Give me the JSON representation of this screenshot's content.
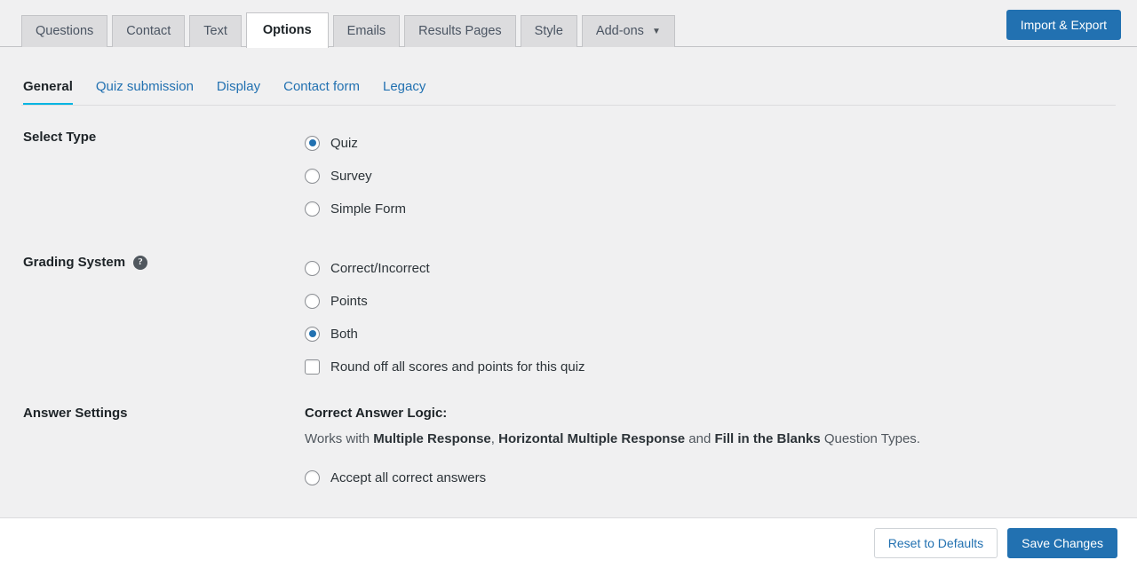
{
  "header": {
    "tabs": [
      {
        "label": "Questions",
        "active": false,
        "caret": false
      },
      {
        "label": "Contact",
        "active": false,
        "caret": false
      },
      {
        "label": "Text",
        "active": false,
        "caret": false
      },
      {
        "label": "Options",
        "active": true,
        "caret": false
      },
      {
        "label": "Emails",
        "active": false,
        "caret": false
      },
      {
        "label": "Results Pages",
        "active": false,
        "caret": false
      },
      {
        "label": "Style",
        "active": false,
        "caret": false
      },
      {
        "label": "Add-ons",
        "active": false,
        "caret": true,
        "caret_glyph": "▼"
      }
    ],
    "import_export_label": "Import & Export"
  },
  "subnav": {
    "items": [
      {
        "label": "General",
        "active": true
      },
      {
        "label": "Quiz submission",
        "active": false
      },
      {
        "label": "Display",
        "active": false
      },
      {
        "label": "Contact form",
        "active": false
      },
      {
        "label": "Legacy",
        "active": false
      }
    ]
  },
  "select_type": {
    "label": "Select Type",
    "options": [
      {
        "label": "Quiz",
        "checked": true
      },
      {
        "label": "Survey",
        "checked": false
      },
      {
        "label": "Simple Form",
        "checked": false
      }
    ]
  },
  "grading_system": {
    "label": "Grading System",
    "help_glyph": "?",
    "options": [
      {
        "label": "Correct/Incorrect",
        "checked": false
      },
      {
        "label": "Points",
        "checked": false
      },
      {
        "label": "Both",
        "checked": true
      }
    ],
    "round_off": {
      "label": "Round off all scores and points for this quiz",
      "checked": false
    }
  },
  "answer_settings": {
    "label": "Answer Settings",
    "logic_title": "Correct Answer Logic:",
    "logic_desc_parts": [
      {
        "text": "Works with ",
        "bold": false
      },
      {
        "text": "Multiple Response",
        "bold": true
      },
      {
        "text": ", ",
        "bold": false
      },
      {
        "text": "Horizontal Multiple Response",
        "bold": true
      },
      {
        "text": " and ",
        "bold": false
      },
      {
        "text": "Fill in the Blanks",
        "bold": true
      },
      {
        "text": " Question Types.",
        "bold": false
      }
    ],
    "options": [
      {
        "label": "Accept all correct answers",
        "checked": false
      }
    ]
  },
  "footer": {
    "reset_label": "Reset to Defaults",
    "save_label": "Save Changes"
  },
  "colors": {
    "accent_blue": "#2271b1",
    "underline_cyan": "#00b5e2",
    "page_bg": "#f0f0f1",
    "tab_bg": "#dcdcde"
  }
}
